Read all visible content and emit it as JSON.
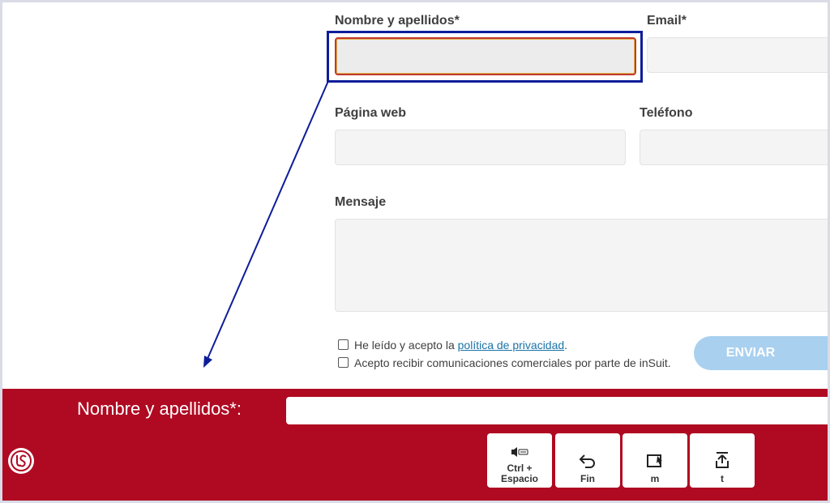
{
  "form": {
    "name_label": "Nombre y apellidos*",
    "email_label": "Email*",
    "web_label": "Página web",
    "phone_label": "Teléfono",
    "message_label": "Mensaje",
    "privacy_prefix": "He leído y acepto la ",
    "privacy_link": "política de privacidad",
    "privacy_suffix": ".",
    "marketing_text": "Acepto recibir comunicaciones comerciales por parte de inSuit.",
    "send_label": "ENVIAR"
  },
  "assist_bar": {
    "field_label": "Nombre y apellidos*:",
    "field_value": "",
    "keys": [
      {
        "icon": "speaker-keyboard-icon",
        "label": "Ctrl +\nEspacio"
      },
      {
        "icon": "undo-icon",
        "label": "Fin"
      },
      {
        "icon": "window-cursor-icon",
        "label": "m"
      },
      {
        "icon": "upload-icon",
        "label": "t"
      }
    ]
  },
  "colors": {
    "bar_red": "#af0a22",
    "focus_blue": "#0d1d9a",
    "button_blue": "#a9d0ef",
    "link_blue": "#1a73a8"
  }
}
